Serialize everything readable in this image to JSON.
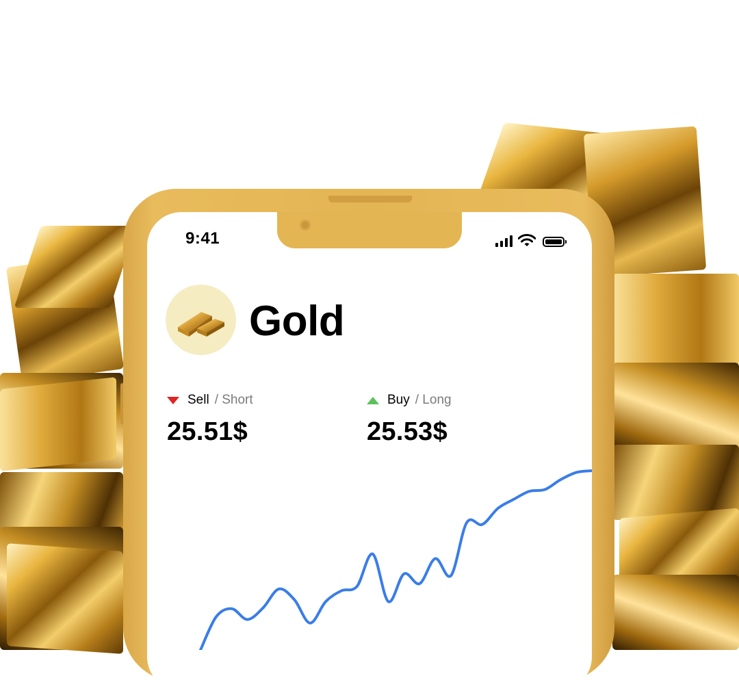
{
  "status_bar": {
    "time": "9:41"
  },
  "asset": {
    "name": "Gold",
    "icon": "gold-bars-icon"
  },
  "quotes": {
    "sell": {
      "side": "Sell",
      "mode": "/ Short",
      "price": "25.51$",
      "color": "#e02424"
    },
    "buy": {
      "side": "Buy",
      "mode": "/ Long",
      "price": "25.53$",
      "color": "#5cc15a"
    }
  },
  "colors": {
    "phone_frame": "#e4b553",
    "avatar_bg": "#f5ecc2",
    "chart_line": "#3a7de8"
  },
  "chart_data": {
    "type": "line",
    "title": "",
    "xlabel": "",
    "ylabel": "",
    "grid": false,
    "legend": "none",
    "x": [
      0,
      1,
      2,
      3,
      4,
      5,
      6,
      7,
      8,
      9,
      10,
      11,
      12,
      13,
      14,
      15,
      16,
      17,
      18,
      19,
      20,
      21,
      22,
      23,
      24,
      25
    ],
    "y": [
      0.0,
      18.5,
      23.0,
      17.0,
      23.5,
      34.0,
      28.0,
      15.0,
      27.0,
      33.0,
      35.5,
      53.5,
      27.0,
      42.5,
      37.0,
      51.0,
      41.5,
      71.0,
      70.0,
      79.0,
      84.0,
      88.5,
      89.5,
      95.0,
      99.0,
      100.0
    ],
    "ylim": [
      0,
      100
    ]
  }
}
